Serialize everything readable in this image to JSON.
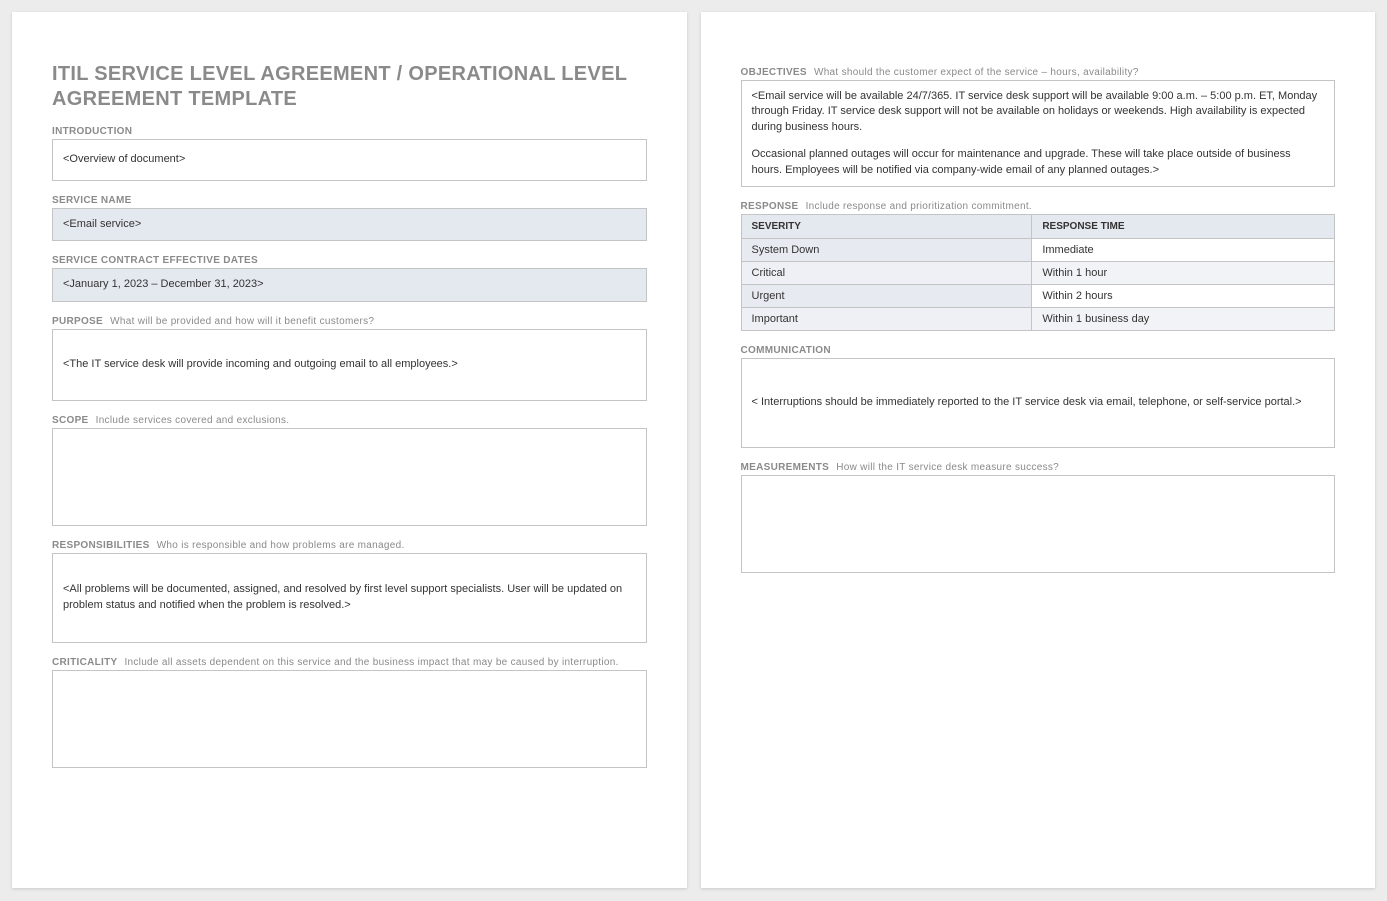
{
  "title": "ITIL SERVICE LEVEL AGREEMENT / OPERATIONAL LEVEL AGREEMENT TEMPLATE",
  "left": {
    "introduction": {
      "label": "INTRODUCTION",
      "value": "<Overview of document>"
    },
    "service_name": {
      "label": "SERVICE NAME",
      "value": "<Email service>"
    },
    "effective_dates": {
      "label": "SERVICE CONTRACT EFFECTIVE DATES",
      "value": "<January 1, 2023 – December 31, 2023>"
    },
    "purpose": {
      "label": "PURPOSE",
      "hint": "What will be provided and how will it benefit customers?",
      "value": "<The IT service desk will provide incoming and outgoing email to all employees.>"
    },
    "scope": {
      "label": "SCOPE",
      "hint": "Include services covered and exclusions.",
      "value": ""
    },
    "responsibilities": {
      "label": "RESPONSIBILITIES",
      "hint": "Who is responsible and how problems are managed.",
      "value": "<All problems will be documented, assigned, and resolved by first level support specialists. User will be updated on problem status and notified when the problem is resolved.>"
    },
    "criticality": {
      "label": "CRITICALITY",
      "hint": "Include all assets dependent on this service and the business impact that may be caused by interruption.",
      "value": ""
    }
  },
  "right": {
    "objectives": {
      "label": "OBJECTIVES",
      "hint": "What should the customer expect of the service – hours, availability?",
      "para1": "<Email service will be available 24/7/365. IT service desk support will be available 9:00 a.m. – 5:00 p.m. ET, Monday through Friday. IT service desk support will not be available on holidays or weekends. High availability is expected during business hours.",
      "para2": "Occasional planned outages will occur for maintenance and upgrade. These will take place outside of business hours. Employees will be notified via company-wide email of any planned outages.>"
    },
    "response": {
      "label": "RESPONSE",
      "hint": "Include response and prioritization commitment.",
      "headers": {
        "severity": "SEVERITY",
        "time": "RESPONSE TIME"
      },
      "rows": [
        {
          "severity": "System Down",
          "time": "Immediate"
        },
        {
          "severity": "Critical",
          "time": "Within 1 hour"
        },
        {
          "severity": "Urgent",
          "time": "Within 2 hours"
        },
        {
          "severity": "Important",
          "time": "Within 1 business day"
        }
      ]
    },
    "communication": {
      "label": "COMMUNICATION",
      "value": "< Interruptions should be immediately reported to the IT service desk via email, telephone, or self-service portal.>"
    },
    "measurements": {
      "label": "MEASUREMENTS",
      "hint": "How will the IT service desk measure success?",
      "value": ""
    }
  }
}
